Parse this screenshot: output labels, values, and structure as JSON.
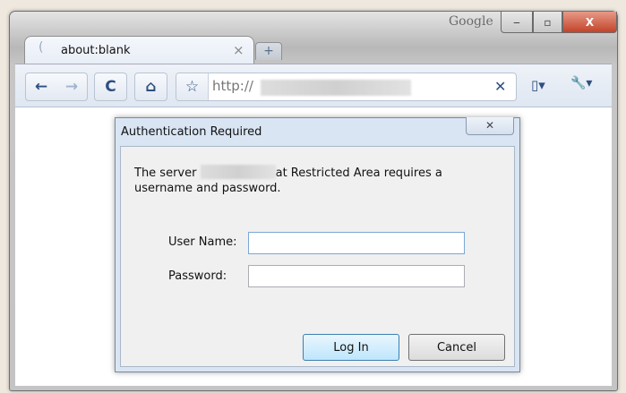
{
  "window": {
    "brand": "Google",
    "minimize": "‒",
    "maximize": "▫",
    "close": "X"
  },
  "tab": {
    "title": "about:blank",
    "close": "×",
    "new_tab": "+"
  },
  "toolbar": {
    "back": "←",
    "forward": "→",
    "reload": "C",
    "home": "⌂",
    "star": "☆",
    "url": "http://",
    "stop": "✕",
    "page_menu": "▯▾",
    "wrench_menu": "🔧▾"
  },
  "dialog": {
    "title": "Authentication Required",
    "close": "✕",
    "message_prefix": "The server",
    "message_suffix": "at Restricted Area requires a",
    "message_line2": "username and password.",
    "username_label": "User Name:",
    "username_value": "",
    "password_label": "Password:",
    "password_value": "",
    "login_label": "Log In",
    "cancel_label": "Cancel"
  }
}
